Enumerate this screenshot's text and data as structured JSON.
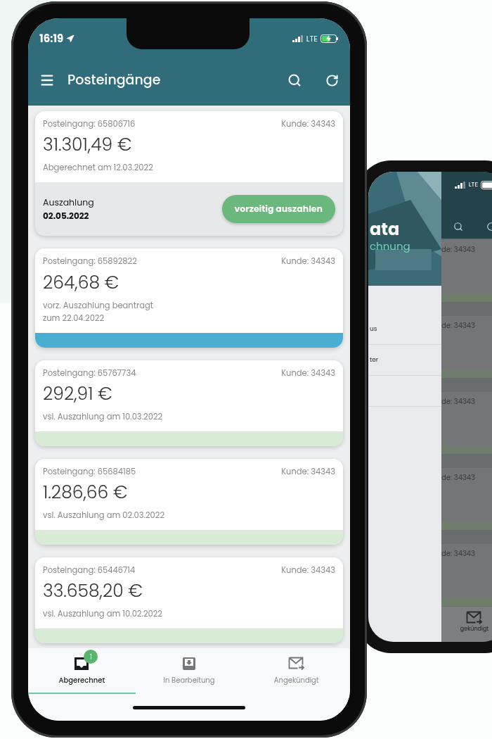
{
  "status_bar": {
    "time": "16:19",
    "network": "LTE"
  },
  "app_bar": {
    "title": "Posteingänge"
  },
  "cards": [
    {
      "kind": "action",
      "inbox": "Posteingang: 65806716",
      "customer": "Kunde: 34343",
      "amount": "31.301,49 €",
      "note": [
        "Abgerechnet am 12.03.2022"
      ],
      "payout_label": "Auszahlung",
      "payout_date": "02.05.2022",
      "button": "vorzeitig auszahlen"
    },
    {
      "kind": "status",
      "color": "#4aaed3",
      "inbox": "Posteingang: 65892822",
      "customer": "Kunde: 34343",
      "amount": "264,68 €",
      "note": [
        "vorz. Auszahlung beantragt",
        "zum 22.04.2022"
      ]
    },
    {
      "kind": "status",
      "color": "#d8ebd4",
      "inbox": "Posteingang: 65767734",
      "customer": "Kunde: 34343",
      "amount": "292,91 €",
      "note": [
        "vsl. Auszahlung am 10.03.2022"
      ]
    },
    {
      "kind": "status",
      "color": "#d8ebd4",
      "inbox": "Posteingang: 65684185",
      "customer": "Kunde: 34343",
      "amount": "1.286,66 €",
      "note": [
        "vsl. Auszahlung am 02.03.2022"
      ]
    },
    {
      "kind": "status",
      "color": "#d8ebd4",
      "inbox": "Posteingang: 65446714",
      "customer": "Kunde: 34343",
      "amount": "33.658,20 €",
      "note": [
        "vsl. Auszahlung am 10.02.2022"
      ]
    }
  ],
  "tabs": [
    {
      "label": "Abgerechnet",
      "selected": true,
      "badge": "1"
    },
    {
      "label": "In Bearbeitung",
      "selected": false
    },
    {
      "label": "Angekündigt",
      "selected": false
    }
  ],
  "back_phone": {
    "network": "LTE",
    "drawer": {
      "brand": "ata",
      "subtitle": "chnung",
      "items": [
        "us",
        "ter"
      ]
    },
    "cards": [
      "de: 34343",
      "de: 34343",
      "de: 34343",
      "de: 34343",
      "de: 34343"
    ],
    "tab": "gekündigt"
  }
}
